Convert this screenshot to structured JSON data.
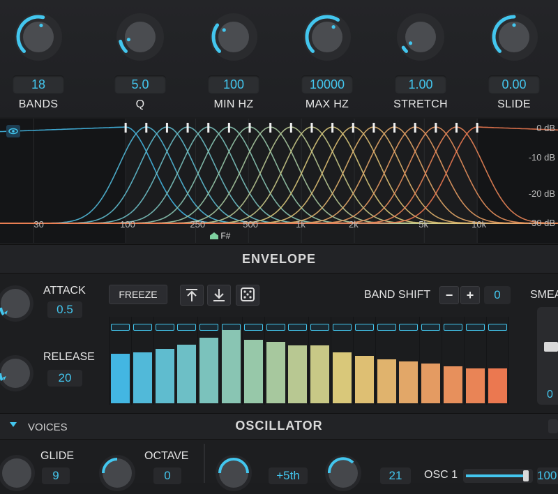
{
  "params": [
    {
      "label": "BANDS",
      "value": "18",
      "level": 0.55
    },
    {
      "label": "Q",
      "value": "5.0",
      "level": 0.12
    },
    {
      "label": "MIN HZ",
      "value": "100",
      "level": 0.3
    },
    {
      "label": "MAX HZ",
      "value": "10000",
      "level": 0.62
    },
    {
      "label": "STRETCH",
      "value": "1.00",
      "level": 0.05
    },
    {
      "label": "SLIDE",
      "value": "0.00",
      "level": 0.5
    }
  ],
  "freq_labels": [
    "30",
    "100",
    "250",
    "500",
    "1k",
    "2k",
    "5k",
    "10k"
  ],
  "db_labels": [
    "0 dB",
    "-10 dB",
    "-20 dB",
    "-30 dB"
  ],
  "note": "F#",
  "envelope": {
    "title": "ENVELOPE",
    "attack_label": "ATTACK",
    "attack_value": "0.5",
    "release_label": "RELEASE",
    "release_value": "20",
    "freeze_label": "FREEZE",
    "band_shift_label": "BAND SHIFT",
    "band_shift_value": "0",
    "minus": "−",
    "plus": "+",
    "smear_label": "SMEA",
    "smear_value": "0",
    "band_levels": [
      0.56,
      0.58,
      0.62,
      0.67,
      0.75,
      0.83,
      0.72,
      0.7,
      0.66,
      0.66,
      0.58,
      0.54,
      0.5,
      0.48,
      0.45,
      0.42,
      0.4,
      0.4
    ]
  },
  "oscillator": {
    "title": "OSCILLATOR",
    "voices_label": "VOICES",
    "glide_label": "GLIDE",
    "glide_value": "9",
    "octave_label": "OCTAVE",
    "octave_value": "0",
    "interval_value": "+5th",
    "num_value": "21",
    "osc1_label": "OSC 1",
    "osc1_value": "100"
  },
  "colors": {
    "accent": "#43c6ee"
  }
}
